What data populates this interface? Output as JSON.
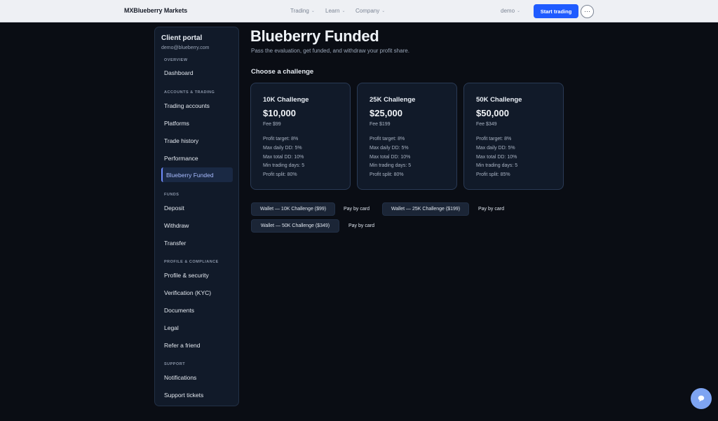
{
  "topbar": {
    "brand": "MXBlueberry Markets",
    "nav": [
      {
        "label": "Trading"
      },
      {
        "label": "Learn"
      },
      {
        "label": "Company"
      }
    ],
    "user": "demo",
    "start_label": "Start trading",
    "more_label": "···"
  },
  "sidebar": {
    "title": "Client portal",
    "email": "demo@blueberry.com",
    "sections": {
      "overview": "OVERVIEW",
      "accounts": "ACCOUNTS & TRADING",
      "funds": "FUNDS",
      "profile": "PROFILE & COMPLIANCE",
      "support": "SUPPORT"
    },
    "items": {
      "dashboard": "Dashboard",
      "trading_accounts": "Trading accounts",
      "platforms": "Platforms",
      "trade_history": "Trade history",
      "performance": "Performance",
      "funded": "Blueberry Funded",
      "deposit": "Deposit",
      "withdraw": "Withdraw",
      "transfer": "Transfer",
      "profile_security": "Profile & security",
      "verification": "Verification (KYC)",
      "documents": "Documents",
      "legal": "Legal",
      "refer": "Refer a friend",
      "notifications": "Notifications",
      "tickets": "Support tickets"
    }
  },
  "main": {
    "title": "Blueberry Funded",
    "subtitle": "Pass the evaluation, get funded, and withdraw your profit share.",
    "section_heading": "Choose a challenge",
    "cards": [
      {
        "name": "10K Challenge",
        "amount": "$10,000",
        "fee": "Fee $99",
        "rules": [
          "Profit target: 8%",
          "Max daily DD: 5%",
          "Max total DD: 10%",
          "Min trading days: 5",
          "Profit split: 80%"
        ]
      },
      {
        "name": "25K Challenge",
        "amount": "$25,000",
        "fee": "Fee $199",
        "rules": [
          "Profit target: 8%",
          "Max daily DD: 5%",
          "Max total DD: 10%",
          "Min trading days: 5",
          "Profit split: 80%"
        ]
      },
      {
        "name": "50K Challenge",
        "amount": "$50,000",
        "fee": "Fee $349",
        "rules": [
          "Profit target: 8%",
          "Max daily DD: 5%",
          "Max total DD: 10%",
          "Min trading days: 5",
          "Profit split: 85%"
        ]
      }
    ],
    "actions": [
      {
        "wallet": "Wallet — 10K Challenge ($99)",
        "card": "Pay by card"
      },
      {
        "wallet": "Wallet — 25K Challenge ($199)",
        "card": "Pay by card"
      },
      {
        "wallet": "Wallet — 50K Challenge ($349)",
        "card": "Pay by card"
      }
    ]
  },
  "colors": {
    "background": "#0a0d14",
    "accent": "#1f5bff",
    "active_nav": "#a9bcff",
    "chat": "#7ea4f2"
  }
}
